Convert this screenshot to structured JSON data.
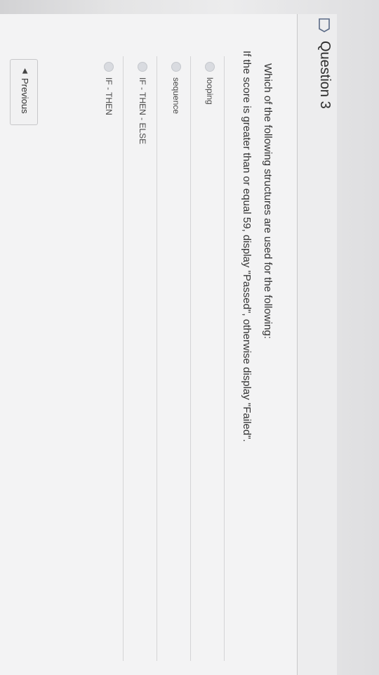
{
  "question": {
    "title": "Question 3",
    "prompt_line1": "Which of the following structures are used for the following:",
    "prompt_line2": "If the score is greater than or equal 59, display \"Passed\", otherwise display \"Failed\"."
  },
  "options": [
    {
      "label": "looping"
    },
    {
      "label": "sequence"
    },
    {
      "label": "IF - THEN - ELSE"
    },
    {
      "label": "IF - THEN"
    }
  ],
  "navigation": {
    "previous_label": "Previous",
    "previous_icon": "triangle-left-icon"
  },
  "colors": {
    "panel": "#f3f3f4",
    "radio": "#d9dbe0"
  }
}
